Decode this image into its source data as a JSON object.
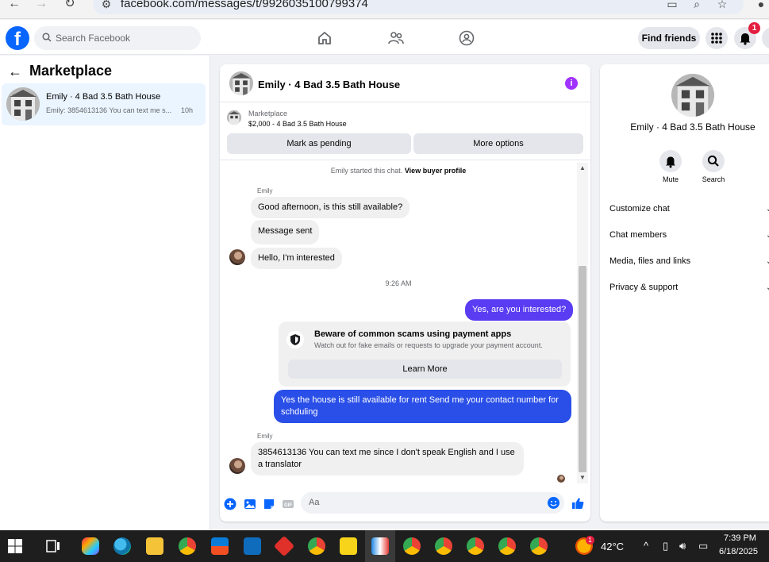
{
  "browser": {
    "url": "facebook.com/messages/t/9926035100799374"
  },
  "header": {
    "search_placeholder": "Search Facebook",
    "find_friends": "Find friends",
    "notification_count": "1"
  },
  "left_panel": {
    "title": "Marketplace",
    "conversation": {
      "name": "Emily · 4 Bad 3.5 Bath House",
      "preview": "Emily: 3854613136 You can text me s...",
      "time": "10h"
    }
  },
  "chat": {
    "title": "Emily · 4 Bad 3.5 Bath House",
    "listing_label": "Marketplace",
    "listing_price": "$2,000 - 4 Bad 3.5 Bath House",
    "mark_pending": "Mark as pending",
    "more_options": "More options",
    "started_text": "Emily started this chat.",
    "view_profile": "View buyer profile",
    "sender_name": "Emily",
    "messages_in_1": [
      "Good afternoon, is this still available?",
      "Message sent",
      "Hello, I'm interested"
    ],
    "time_divider": "9:26 AM",
    "out_1": "Yes, are you interested?",
    "scam_title": "Beware of common scams using payment apps",
    "scam_text": "Watch out for fake emails or requests to upgrade your payment account.",
    "learn_more": "Learn More",
    "out_2": "Yes the house is still available for rent Send me your contact number for schduling",
    "in_2": "3854613136 You can text me since I don't speak English and I use a translator",
    "compose_placeholder": "Aa"
  },
  "right_panel": {
    "title": "Emily · 4 Bad 3.5 Bath House",
    "mute": "Mute",
    "search": "Search",
    "rows": [
      "Customize chat",
      "Chat members",
      "Media, files and links",
      "Privacy & support"
    ]
  },
  "taskbar": {
    "temperature": "42°C",
    "time": "7:39 PM",
    "date": "6/18/2025",
    "weather_badge": "1"
  }
}
